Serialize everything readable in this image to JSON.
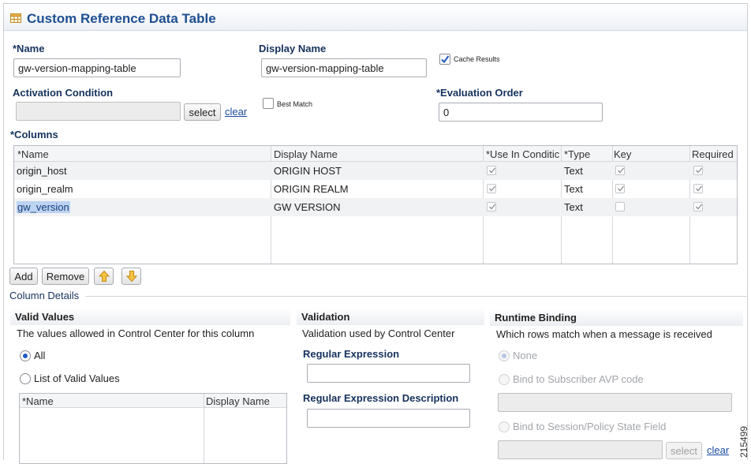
{
  "header": {
    "title": "Custom Reference Data Table",
    "icon": "table-icon"
  },
  "form": {
    "name_label": "*Name",
    "name_value": "gw-version-mapping-table",
    "display_name_label": "Display Name",
    "display_name_value": "gw-version-mapping-table",
    "cache_results_label": "Cache Results",
    "cache_results_checked": true,
    "activation_condition_label": "Activation Condition",
    "activation_condition_value": "",
    "select_label": "select",
    "clear_label": "clear",
    "best_match_label": "Best Match",
    "best_match_checked": false,
    "evaluation_order_label": "*Evaluation Order",
    "evaluation_order_value": "0"
  },
  "columns": {
    "label": "*Columns",
    "headers": [
      "*Name",
      "Display Name",
      "*Use In Conditic",
      "*Type",
      "Key",
      "Required"
    ],
    "rows": [
      {
        "name": "origin_host",
        "display_name": "ORIGIN HOST",
        "use_in_condition": true,
        "type": "Text",
        "key": true,
        "required": true
      },
      {
        "name": "origin_realm",
        "display_name": "ORIGIN REALM",
        "use_in_condition": true,
        "type": "Text",
        "key": true,
        "required": true
      },
      {
        "name": "gw_version",
        "display_name": "GW VERSION",
        "use_in_condition": true,
        "type": "Text",
        "key": false,
        "required": true
      }
    ],
    "add_label": "Add",
    "remove_label": "Remove"
  },
  "column_details": {
    "title": "Column Details",
    "valid_values": {
      "title": "Valid Values",
      "description": "The values allowed in Control Center for this column",
      "all_label": "All",
      "list_label": "List of Valid Values",
      "selected": "All",
      "grid_headers": [
        "*Name",
        "Display Name"
      ]
    },
    "validation": {
      "title": "Validation",
      "description": "Validation used by Control Center",
      "regex_label": "Regular Expression",
      "regex_value": "",
      "regex_desc_label": "Regular Expression Description",
      "regex_desc_value": ""
    },
    "runtime_binding": {
      "title": "Runtime Binding",
      "description": "Which rows match when a message is received",
      "none_label": "None",
      "avp_label": "Bind to Subscriber AVP code",
      "session_label": "Bind to Session/Policy State Field",
      "select_label": "select",
      "clear_label": "clear",
      "selected": "None"
    }
  },
  "figure_number": "215499",
  "colors": {
    "title": "#1d4f91",
    "label": "#15325d",
    "link": "#1a4ba0",
    "selection": "#bcd3f2"
  }
}
